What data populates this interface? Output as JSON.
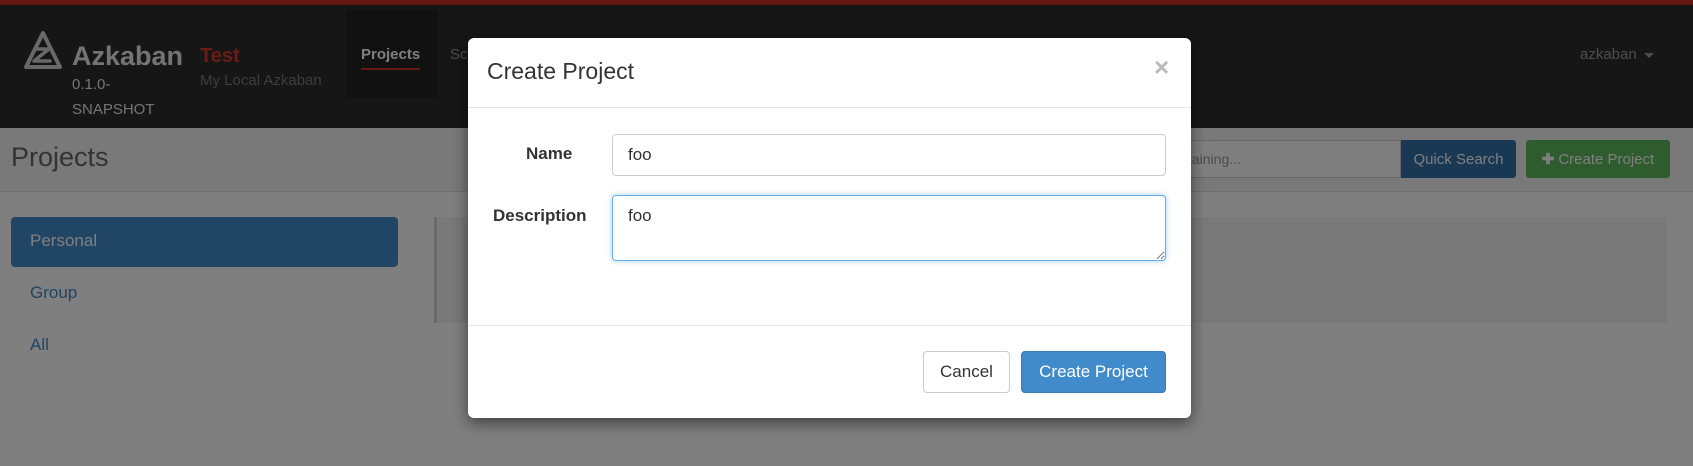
{
  "colors": {
    "topbar_accent": "#c9301f",
    "env_name": "#d9392a",
    "projects_underline": "#c9301f",
    "primary_blue": "#428bca",
    "quick_search_blue": "#3071a9",
    "create_green": "#5cb85c",
    "link_blue": "#428bca"
  },
  "navbar": {
    "logo_icon": "azkaban-logo-icon",
    "brand": "Azkaban",
    "version": "0.1.0-SNAPSHOT",
    "env_name": "Test",
    "env_description": "My Local Azkaban",
    "tabs": [
      {
        "label": "Projects",
        "active": true
      },
      {
        "label": "Sc",
        "active": false
      }
    ],
    "user": "azkaban"
  },
  "page_header": {
    "title": "Projects",
    "search_placeholder": "taining...",
    "quick_search_label": "Quick Search",
    "create_project_icon": "plus-icon",
    "create_project_label": "Create Project"
  },
  "sidebar": {
    "items": [
      {
        "label": "Personal",
        "active": true
      },
      {
        "label": "Group",
        "active": false
      },
      {
        "label": "All",
        "active": false
      }
    ]
  },
  "modal": {
    "title": "Create Project",
    "close_glyph": "×",
    "name_label": "Name",
    "name_value": "foo",
    "description_label": "Description",
    "description_value": "foo",
    "cancel_label": "Cancel",
    "create_label": "Create Project"
  }
}
